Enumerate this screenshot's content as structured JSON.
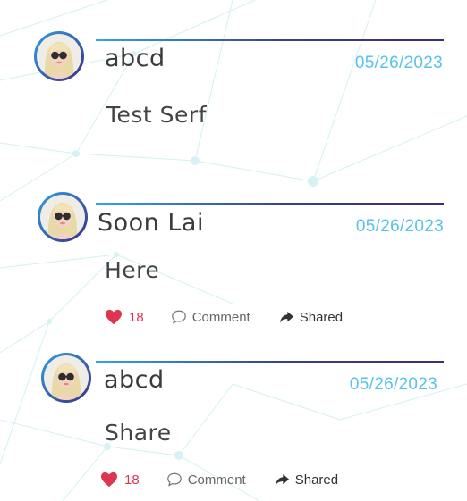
{
  "posts": [
    {
      "author": "abcd",
      "date": "05/26/2023",
      "text": "Test Serf",
      "avatar_icon": "user-avatar-woman-sunglasses"
    },
    {
      "author": "Soon Lai",
      "date": "05/26/2023",
      "text": "Here",
      "avatar_icon": "user-avatar-woman-sunglasses",
      "likes": "18",
      "comment_label": "Comment",
      "share_label": "Shared"
    },
    {
      "author": "abcd",
      "date": "05/26/2023",
      "text": "Share",
      "avatar_icon": "user-avatar-woman-sunglasses",
      "likes": "18",
      "comment_label": "Comment",
      "share_label": "Shared"
    }
  ],
  "colors": {
    "accent_date": "#56c3eb",
    "like": "#e03552",
    "rule_start": "#30a6e6",
    "rule_end": "#3a2d7a"
  },
  "icons": {
    "like": "heart-icon",
    "comment": "comment-bubble-icon",
    "share": "share-arrow-icon"
  }
}
